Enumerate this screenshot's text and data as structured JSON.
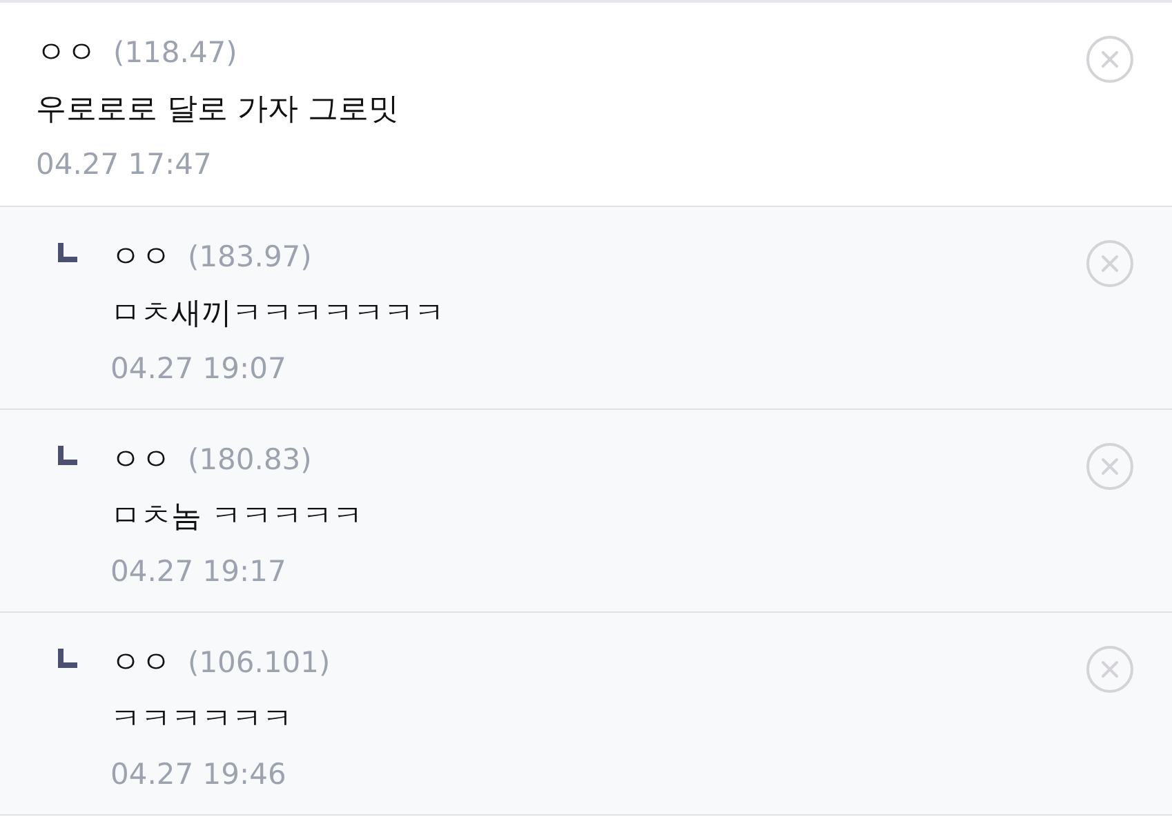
{
  "comments": [
    {
      "author": "ㅇㅇ",
      "ip": "(118.47)",
      "text": "우로로로 달로 가자 그로밋",
      "time": "04.27 17:47",
      "replies": [
        {
          "author": "ㅇㅇ",
          "ip": "(183.97)",
          "text": "ㅁㅊ새끼ㅋㅋㅋㅋㅋㅋㅋ",
          "time": "04.27 19:07"
        },
        {
          "author": "ㅇㅇ",
          "ip": "(180.83)",
          "text": "ㅁㅊ놈 ㅋㅋㅋㅋㅋ",
          "time": "04.27 19:17"
        },
        {
          "author": "ㅇㅇ",
          "ip": "(106.101)",
          "text": "ㅋㅋㅋㅋㅋㅋ",
          "time": "04.27 19:46"
        }
      ]
    }
  ]
}
